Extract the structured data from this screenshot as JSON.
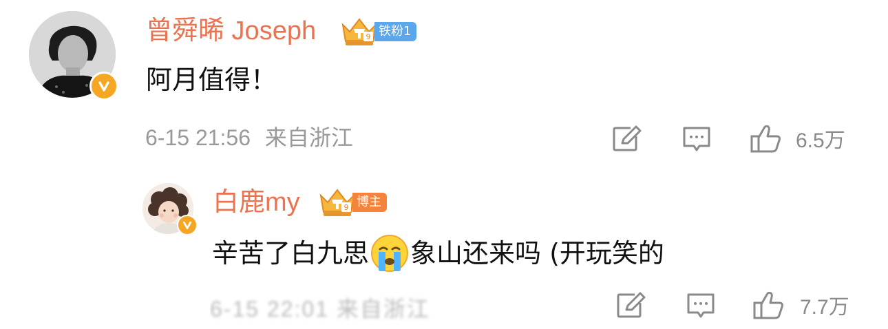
{
  "comment": {
    "username": "曾舜晞 Joseph",
    "fan_badge": "铁粉1",
    "text": "阿月值得！",
    "time": "6-15 21:56",
    "location": "来自浙江",
    "likes": "6.5万",
    "icons": {
      "avatar": "avatar-photo",
      "verified": "verified-v-icon",
      "crown": "crown-badge-icon",
      "repost": "repost-icon",
      "reply": "reply-icon",
      "like": "like-thumb-icon"
    }
  },
  "reply": {
    "username": "白鹿my",
    "blogger_badge": "博主",
    "text_before_emoji": "辛苦了白九思",
    "emoji": "crying-face-emoji",
    "text_after_emoji": "象山还来吗 (开玩笑的",
    "meta_blurred": "6-15 22:01 来自浙江",
    "likes": "7.7万",
    "icons": {
      "avatar": "avatar-photo",
      "verified": "verified-v-icon",
      "crown": "crown-badge-icon",
      "repost": "repost-icon",
      "reply": "reply-icon",
      "like": "like-thumb-icon"
    }
  },
  "colors": {
    "username": "#eb7350",
    "meta": "#999999",
    "fan_tag": "#5aa7ee",
    "blogger_tag": "#f5833b",
    "verified": "#f5a623"
  }
}
